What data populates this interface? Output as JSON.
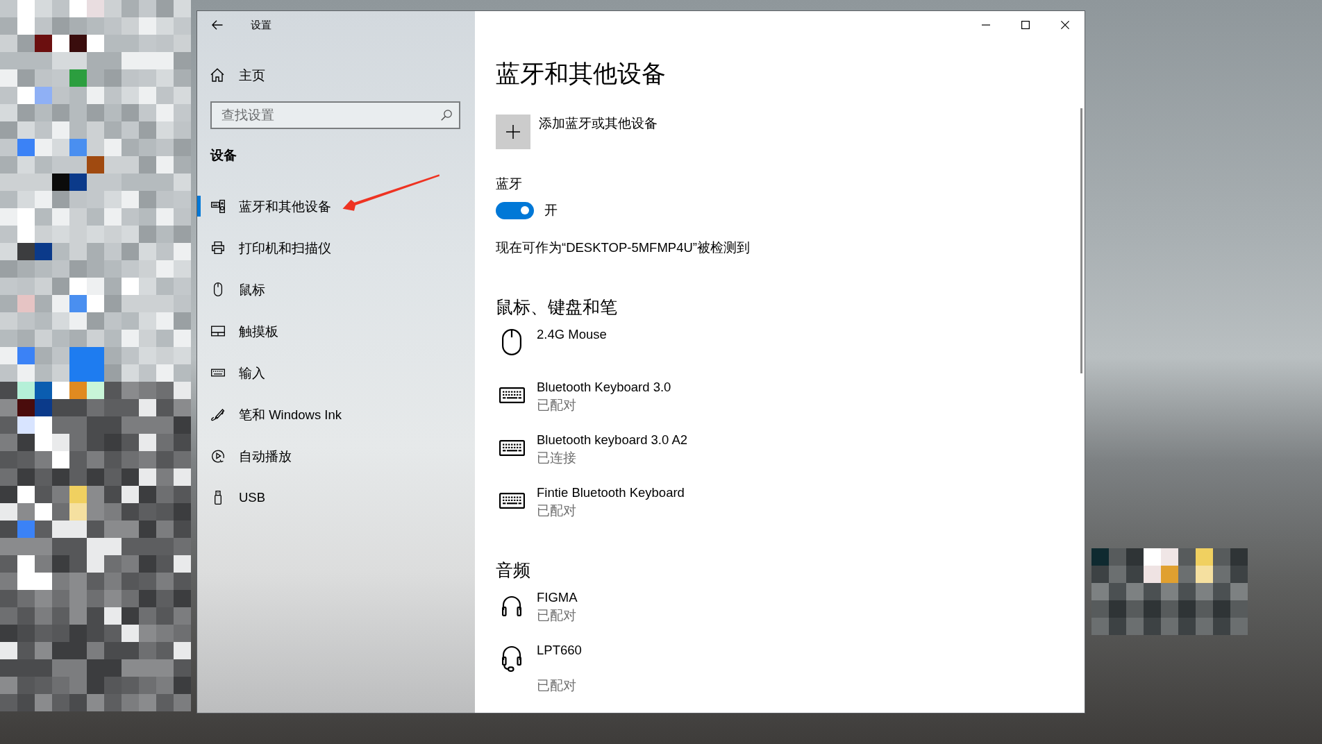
{
  "window": {
    "title": "设置"
  },
  "sidebar": {
    "home": "主页",
    "search": {
      "placeholder": "查找设置"
    },
    "heading": "设备",
    "items": [
      {
        "kind": "bluetooth",
        "label": "蓝牙和其他设备",
        "selected": true
      },
      {
        "kind": "printer",
        "label": "打印机和扫描仪",
        "selected": false
      },
      {
        "kind": "mouse",
        "label": "鼠标",
        "selected": false
      },
      {
        "kind": "touchpad",
        "label": "触摸板",
        "selected": false
      },
      {
        "kind": "keyboard",
        "label": "输入",
        "selected": false
      },
      {
        "kind": "pen",
        "label": "笔和 Windows Ink",
        "selected": false
      },
      {
        "kind": "autoplay",
        "label": "自动播放",
        "selected": false
      },
      {
        "kind": "usb",
        "label": "USB",
        "selected": false
      }
    ]
  },
  "page": {
    "title": "蓝牙和其他设备",
    "add_device": "添加蓝牙或其他设备",
    "bluetooth": {
      "label": "蓝牙",
      "on": true,
      "state_text": "开"
    },
    "discoverable": "现在可作为“DESKTOP-5MFMP4U”被检测到",
    "sections": [
      {
        "title": "鼠标、键盘和笔",
        "devices": [
          {
            "kind": "mouse",
            "name": "2.4G Mouse"
          },
          {
            "kind": "keyboard",
            "name": "Bluetooth Keyboard 3.0",
            "status": "已配对"
          },
          {
            "kind": "keyboard",
            "name": "Bluetooth keyboard 3.0 A2",
            "status": "已连接"
          },
          {
            "kind": "keyboard",
            "name": "Fintie Bluetooth Keyboard",
            "status": "已配对"
          }
        ]
      },
      {
        "title": "音频",
        "devices": [
          {
            "kind": "headphones",
            "name": "FIGMA",
            "status": "已配对"
          },
          {
            "kind": "headset",
            "name": "LPT660",
            "status": "已配对"
          }
        ]
      }
    ]
  }
}
